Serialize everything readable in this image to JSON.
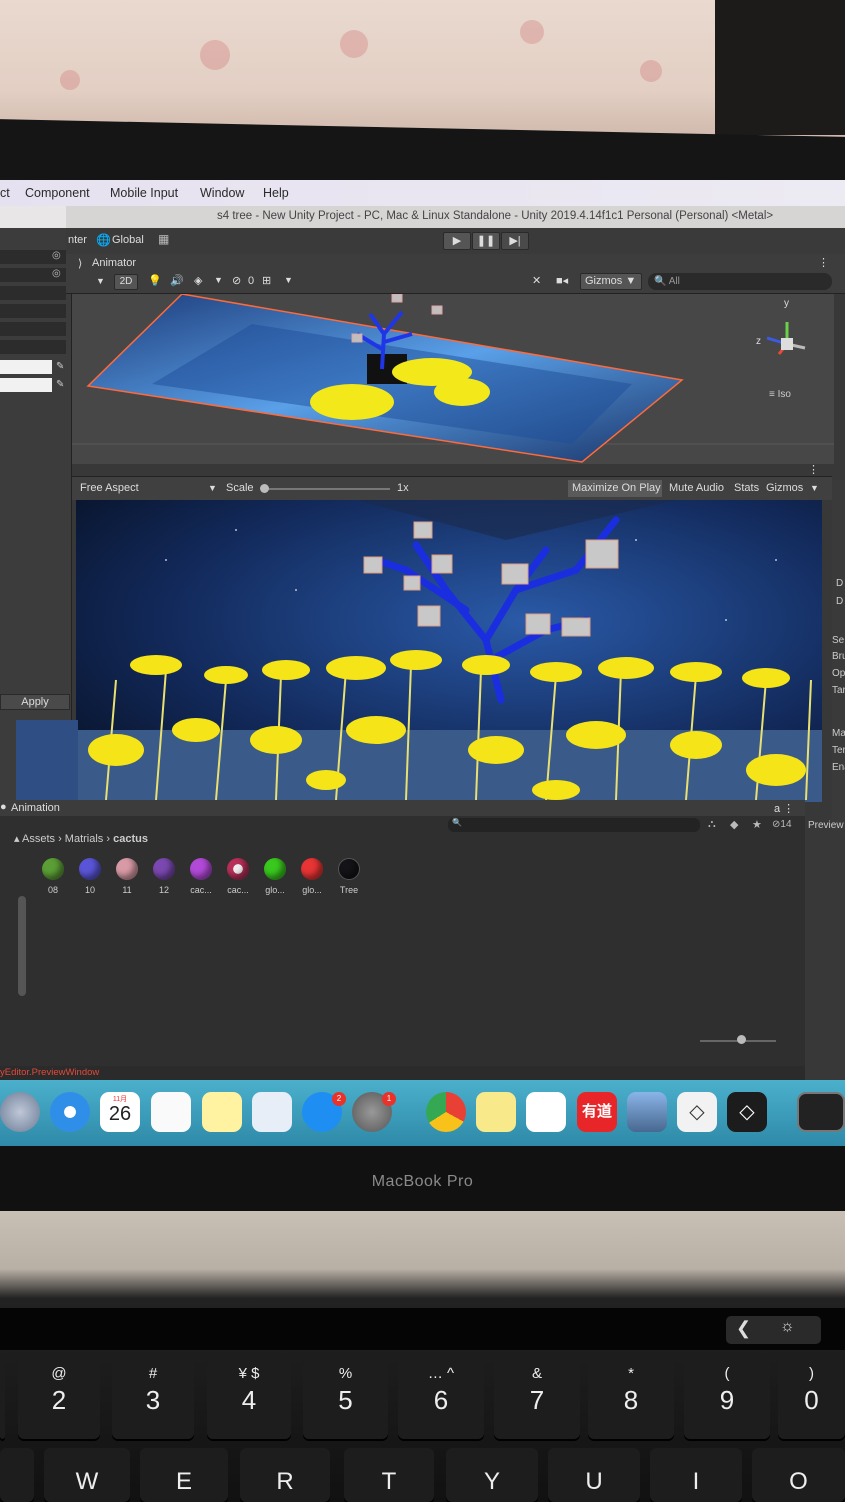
{
  "menubar": {
    "items": [
      "ct",
      "Component",
      "Mobile Input",
      "Window",
      "Help"
    ]
  },
  "window": {
    "title": "s4 tree - New Unity Project - PC, Mac & Linux Standalone - Unity 2019.4.14f1c1 Personal (Personal) <Metal>"
  },
  "toolbar": {
    "pivot_label": "nter",
    "space_label": "Global",
    "play_icon": "play-icon",
    "pause_icon": "pause-icon",
    "step_icon": "step-icon"
  },
  "scene": {
    "tab_label": "Animator",
    "mode_2d": "2D",
    "hidden_count": "0",
    "gizmos_label": "Gizmos",
    "search_placeholder": "All",
    "iso_label": "Iso",
    "axis_y": "y",
    "axis_z": "z"
  },
  "game": {
    "aspect": "Free Aspect",
    "scale_label": "Scale",
    "scale_value": "1x",
    "maximize_label": "Maximize On Play",
    "mute_label": "Mute Audio",
    "stats_label": "Stats",
    "gizmos_label": "Gizmos"
  },
  "inspector": {
    "apply_label": "Apply",
    "right_labels": [
      "D",
      "D",
      "Se",
      "Bru",
      "Op",
      "Tar",
      "Mat",
      "Terr",
      "Enal"
    ]
  },
  "animation": {
    "tab_label": "Animation",
    "preview_label": "Preview"
  },
  "project": {
    "breadcrumb": [
      "Assets",
      "Matrials",
      "cactus"
    ],
    "hidden_count": "14",
    "assets": [
      {
        "label": "08",
        "color": "#5b9e36"
      },
      {
        "label": "10",
        "color": "#5a55d8"
      },
      {
        "label": "11",
        "color": "#d89aa6"
      },
      {
        "label": "12",
        "color": "#7a48b0"
      },
      {
        "label": "cac...",
        "color": "#b24ad8"
      },
      {
        "label": "cac...",
        "color": "#b8305a"
      },
      {
        "label": "glo...",
        "color": "#39c81e"
      },
      {
        "label": "glo...",
        "color": "#e83434"
      },
      {
        "label": "Tree",
        "color": "#141418"
      }
    ]
  },
  "status": {
    "text": "yEditor.PreviewWindow"
  },
  "dock": {
    "calendar_month": "11月",
    "calendar_day": "26",
    "appstore_badge": "2",
    "settings_badge": "1",
    "youdao_label": "有道"
  },
  "laptop": {
    "brand": "MacBook Pro"
  },
  "keyboard": {
    "number_row": [
      {
        "sym": "@",
        "main": "2"
      },
      {
        "sym": "#",
        "main": "3"
      },
      {
        "sym": "¥ $",
        "main": "4"
      },
      {
        "sym": "%",
        "main": "5"
      },
      {
        "sym": "… ^",
        "main": "6"
      },
      {
        "sym": "&",
        "main": "7"
      },
      {
        "sym": "*",
        "main": "8"
      },
      {
        "sym": "(",
        "main": "9"
      },
      {
        "sym": ")",
        "main": "0"
      }
    ],
    "letter_row": [
      "W",
      "E",
      "R",
      "T",
      "Y",
      "U",
      "I",
      "O"
    ]
  }
}
